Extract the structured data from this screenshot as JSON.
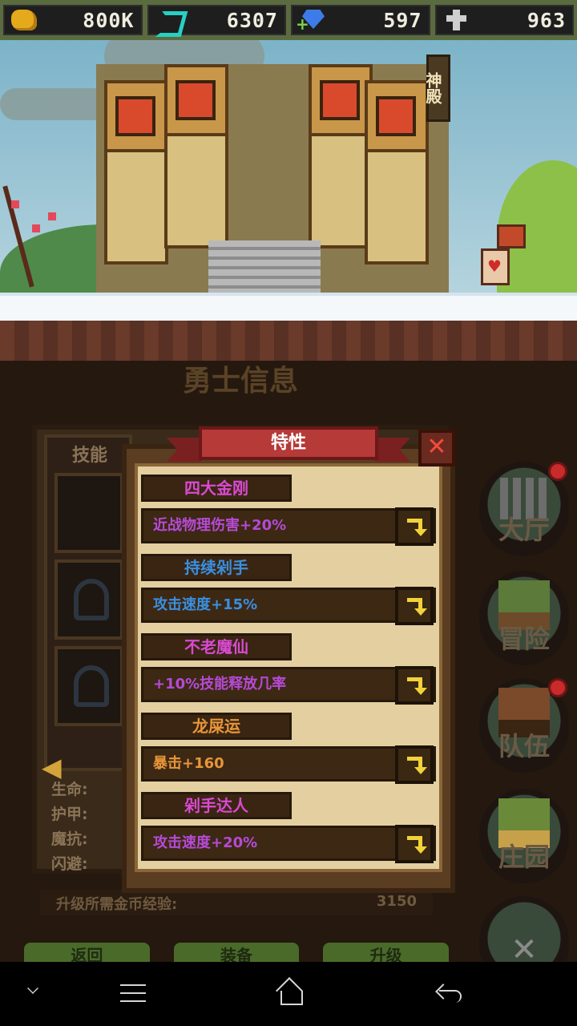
{
  "resources": {
    "gold": {
      "value": "800K",
      "icon": "gold-nugget-icon",
      "color": "#e5a91c"
    },
    "energy": {
      "value": "6307",
      "icon": "energy-icon",
      "color": "#27d0c4"
    },
    "gems": {
      "value": "597",
      "icon": "gem-icon",
      "color": "#3d7be8"
    },
    "cross": {
      "value": "963",
      "icon": "cross-icon",
      "color": "#cfcfcf"
    }
  },
  "scene": {
    "temple_sign": "神殿"
  },
  "hero_panel": {
    "title": "勇士信息",
    "skills_label": "技能",
    "stats": [
      "生命:",
      "护甲:",
      "魔抗:",
      "闪避:"
    ],
    "xp_label": "升级所需金币经验:",
    "xp_value": "3150",
    "buttons": [
      "返回",
      "装备",
      "升级"
    ]
  },
  "side_menu": [
    {
      "label": "大厅",
      "icon": "hall-icon",
      "badge": true
    },
    {
      "label": "冒险",
      "icon": "adventure-icon",
      "badge": false
    },
    {
      "label": "队伍",
      "icon": "team-icon",
      "badge": true
    },
    {
      "label": "庄园",
      "icon": "manor-icon",
      "badge": false
    }
  ],
  "dialog": {
    "title": "特性",
    "close": "✕",
    "traits": [
      {
        "name": "四大金刚",
        "name_color": "#d94ad1",
        "effect": "近战物理伤害+20%",
        "effect_color": "#b64ad6"
      },
      {
        "name": "持续剁手",
        "name_color": "#3a8fe0",
        "effect": "攻击速度+15%",
        "effect_color": "#3a8fe0"
      },
      {
        "name": "不老魔仙",
        "name_color": "#d94ad1",
        "effect": "+10%技能释放几率",
        "effect_color": "#b64ad6"
      },
      {
        "name": "龙屎运",
        "name_color": "#e8963a",
        "effect": "暴击+160",
        "effect_color": "#e8963a"
      },
      {
        "name": "剁手达人",
        "name_color": "#d94ad1",
        "effect": "攻击速度+20%",
        "effect_color": "#b64ad6"
      }
    ]
  },
  "navbar": {
    "items": [
      "collapse",
      "menu",
      "home",
      "back"
    ]
  }
}
